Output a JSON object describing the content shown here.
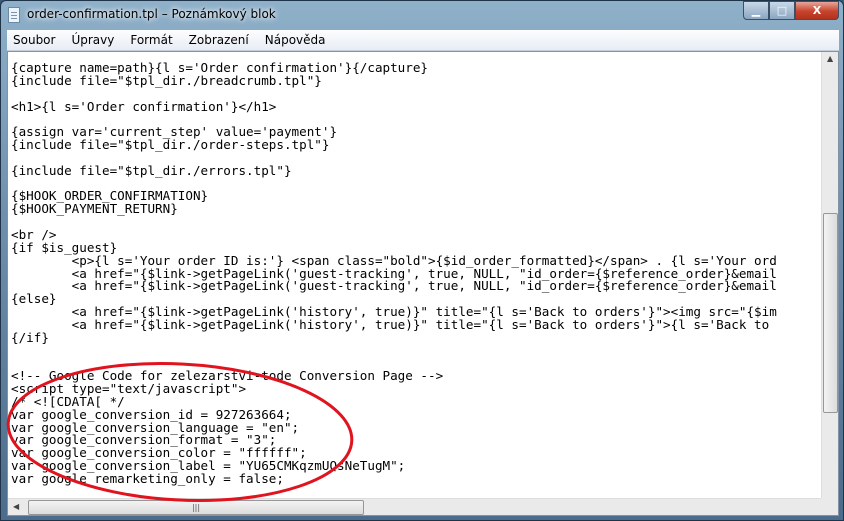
{
  "window": {
    "title": "order-confirmation.tpl – Poznámkový blok",
    "min": "▁",
    "max": "□",
    "close": "X"
  },
  "menu": [
    "Soubor",
    "Úpravy",
    "Formát",
    "Zobrazení",
    "Nápověda"
  ],
  "lines": [
    "{capture name=path}{l s='Order confirmation'}{/capture}",
    "{include file=\"$tpl_dir./breadcrumb.tpl\"}",
    "",
    "<h1>{l s='Order confirmation'}</h1>",
    "",
    "{assign var='current_step' value='payment'}",
    "{include file=\"$tpl_dir./order-steps.tpl\"}",
    "",
    "{include file=\"$tpl_dir./errors.tpl\"}",
    "",
    "{$HOOK_ORDER_CONFIRMATION}",
    "{$HOOK_PAYMENT_RETURN}",
    "",
    "<br />",
    "{if $is_guest}",
    "        <p>{l s='Your order ID is:'} <span class=\"bold\">{$id_order_formatted}</span> . {l s='Your ord",
    "        <a href=\"{$link->getPageLink('guest-tracking', true, NULL, \"id_order={$reference_order}&email",
    "        <a href=\"{$link->getPageLink('guest-tracking', true, NULL, \"id_order={$reference_order}&email",
    "{else}",
    "        <a href=\"{$link->getPageLink('history', true)}\" title=\"{l s='Back to orders'}\"><img src=\"{$im",
    "        <a href=\"{$link->getPageLink('history', true)}\" title=\"{l s='Back to orders'}\">{l s='Back to",
    "{/if}",
    "",
    "",
    "<!-- Google Code for zelezarstvi-tode Conversion Page -->",
    "<script type=\"text/javascript\">",
    "/* <![CDATA[ */",
    "var google_conversion_id = 927263664;",
    "var google_conversion_language = \"en\";",
    "var google_conversion_format = \"3\";",
    "var google_conversion_color = \"ffffff\";",
    "var google_conversion_label = \"YU65CMKqzmUQsNeTugM\";",
    "var google_remarketing_only = false;"
  ],
  "annotation_color": "#e0141e",
  "scroll": {
    "vertical_position_percent": 60,
    "horizontal_position_percent": 0
  }
}
